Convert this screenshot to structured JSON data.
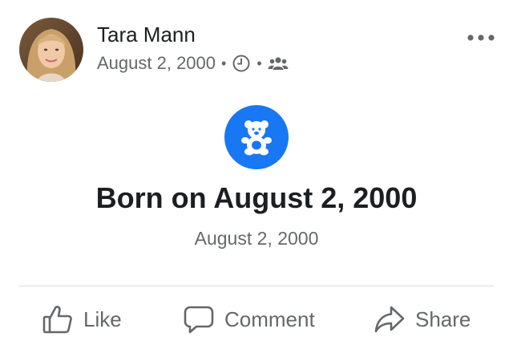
{
  "post": {
    "author": "Tara Mann",
    "date": "August 2, 2000",
    "audience": "friends",
    "privacy_icon": "clock-icon",
    "audience_icon": "friends-icon",
    "more_icon": "more-options-icon"
  },
  "event": {
    "icon": "teddy-bear-icon",
    "title": "Born on August 2, 2000",
    "date": "August 2, 2000"
  },
  "actions": {
    "like": "Like",
    "comment": "Comment",
    "share": "Share"
  },
  "colors": {
    "accent": "#1877f2",
    "text_primary": "#1c1e21",
    "text_secondary": "#65676b",
    "divider": "#dadde1"
  }
}
